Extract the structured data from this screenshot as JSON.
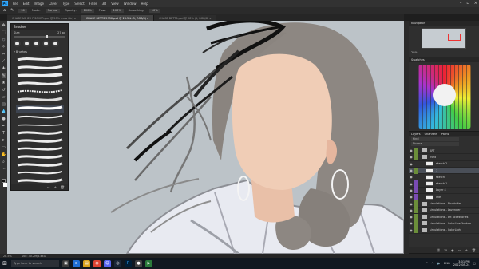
{
  "app": {
    "logo": "Ps"
  },
  "menubar": {
    "items": [
      "File",
      "Edit",
      "Image",
      "Layer",
      "Type",
      "Select",
      "Filter",
      "3D",
      "View",
      "Window",
      "Help"
    ]
  },
  "options": {
    "size": "30",
    "mode_label": "Mode:",
    "mode": "Normal",
    "opacity_label": "Opacity:",
    "opacity": "100%",
    "flow_label": "Flow:",
    "flow": "100%",
    "smoothing_label": "Smoothing:",
    "smoothing": "10%"
  },
  "tabs": [
    {
      "label": "CHASE ASHER FISCHER.psd @ 50% (new file) x"
    },
    {
      "label": "CHASE BETTS 5936.psd @ 28.5% (5, RGB/8) x"
    },
    {
      "label": "CHASE BETTS.psd @ 28% (5, RGB/8) x"
    }
  ],
  "brushes_panel": {
    "title": "Brushes",
    "size_label": "Size:",
    "size_value": "27 px",
    "folder": "Brushes"
  },
  "navigator": {
    "title": "Navigator",
    "zoom": "28%"
  },
  "color_panel": {
    "title": "Swatches"
  },
  "layers_panel": {
    "tab_layers": "Layers",
    "tab_channels": "Channels",
    "tab_paths": "Paths",
    "kind": "Kind",
    "blend": "Normal",
    "rows": [
      {
        "name": "ART",
        "type": "folder",
        "tag": "#6b8e3a"
      },
      {
        "name": "front",
        "type": "folder",
        "tag": "#6b8e3a"
      },
      {
        "name": "sketch 2",
        "type": "layer",
        "tag": ""
      },
      {
        "name": "1",
        "type": "layer",
        "tag": "#6b8e3a",
        "selected": true
      },
      {
        "name": "sketch",
        "type": "layer",
        "tag": ""
      },
      {
        "name": "sketch 1",
        "type": "layer",
        "tag": "#7a4bb3"
      },
      {
        "name": "Layer 4",
        "type": "layer",
        "tag": "#7a4bb3"
      },
      {
        "name": "line",
        "type": "layer",
        "tag": "#7a4bb3"
      },
      {
        "name": "simulations - Rhodolite",
        "type": "folder",
        "tag": "#6b8e3a"
      },
      {
        "name": "simulations - Lavender",
        "type": "folder",
        "tag": "#6b8e3a"
      },
      {
        "name": "simulations - art accessories",
        "type": "folder",
        "tag": "#6b8e3a"
      },
      {
        "name": "simulations - ColorLineShadow",
        "type": "folder",
        "tag": "#6b8e3a"
      },
      {
        "name": "simulations - ColorLight",
        "type": "folder",
        "tag": "#6b8e3a"
      }
    ]
  },
  "status": {
    "zoom": "28.5%",
    "doc": "Doc: 30.2M/6.44G"
  },
  "taskbar": {
    "search_placeholder": "Type here to search",
    "lang": "ENG",
    "time": "3:01 PM",
    "date": "2022-08-24"
  },
  "colors": {
    "accent": "#31a8ff",
    "skin": "#f0cdb6",
    "hair": "#8d8782",
    "canvas": "#bcc3c8"
  }
}
